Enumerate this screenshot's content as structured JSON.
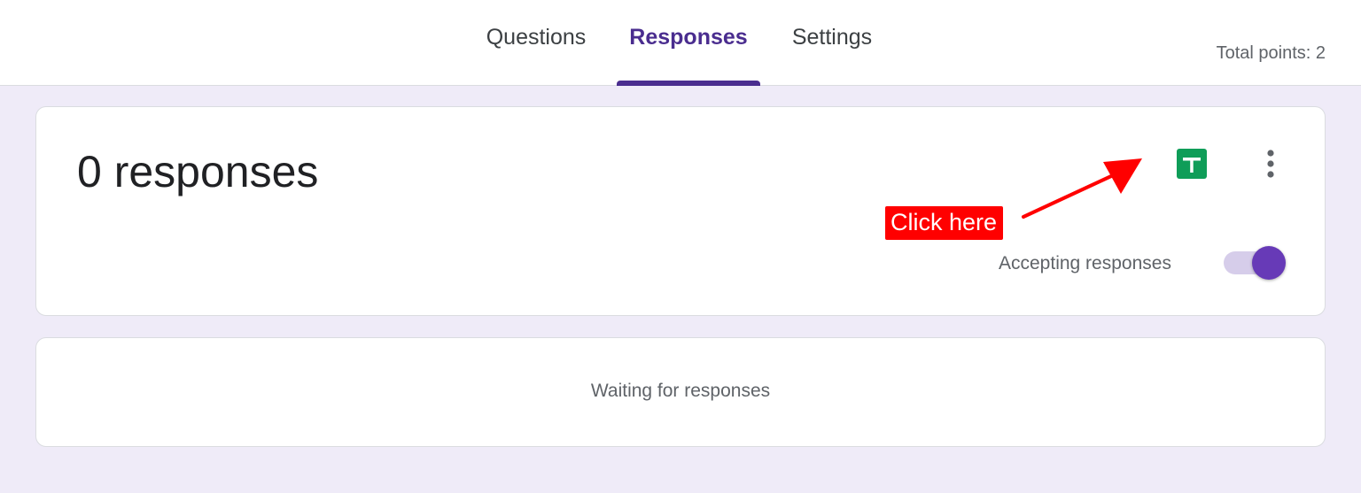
{
  "header": {
    "tabs": [
      {
        "label": "Questions",
        "active": false
      },
      {
        "label": "Responses",
        "active": true
      },
      {
        "label": "Settings",
        "active": false
      }
    ],
    "total_points": "Total points: 2"
  },
  "summary_card": {
    "response_count": "0 responses",
    "sheets_icon": "google-sheets-icon",
    "more_icon": "more-vert-icon",
    "annotation_label": "Click here",
    "accepting_label": "Accepting responses",
    "accepting_on": true
  },
  "waiting_card": {
    "message": "Waiting for responses"
  },
  "colors": {
    "accent": "#673ab7",
    "tab_active": "#4a2d8f",
    "sheets_green": "#0f9d58",
    "annotation_red": "#ff0000",
    "page_background": "#efebf8"
  }
}
